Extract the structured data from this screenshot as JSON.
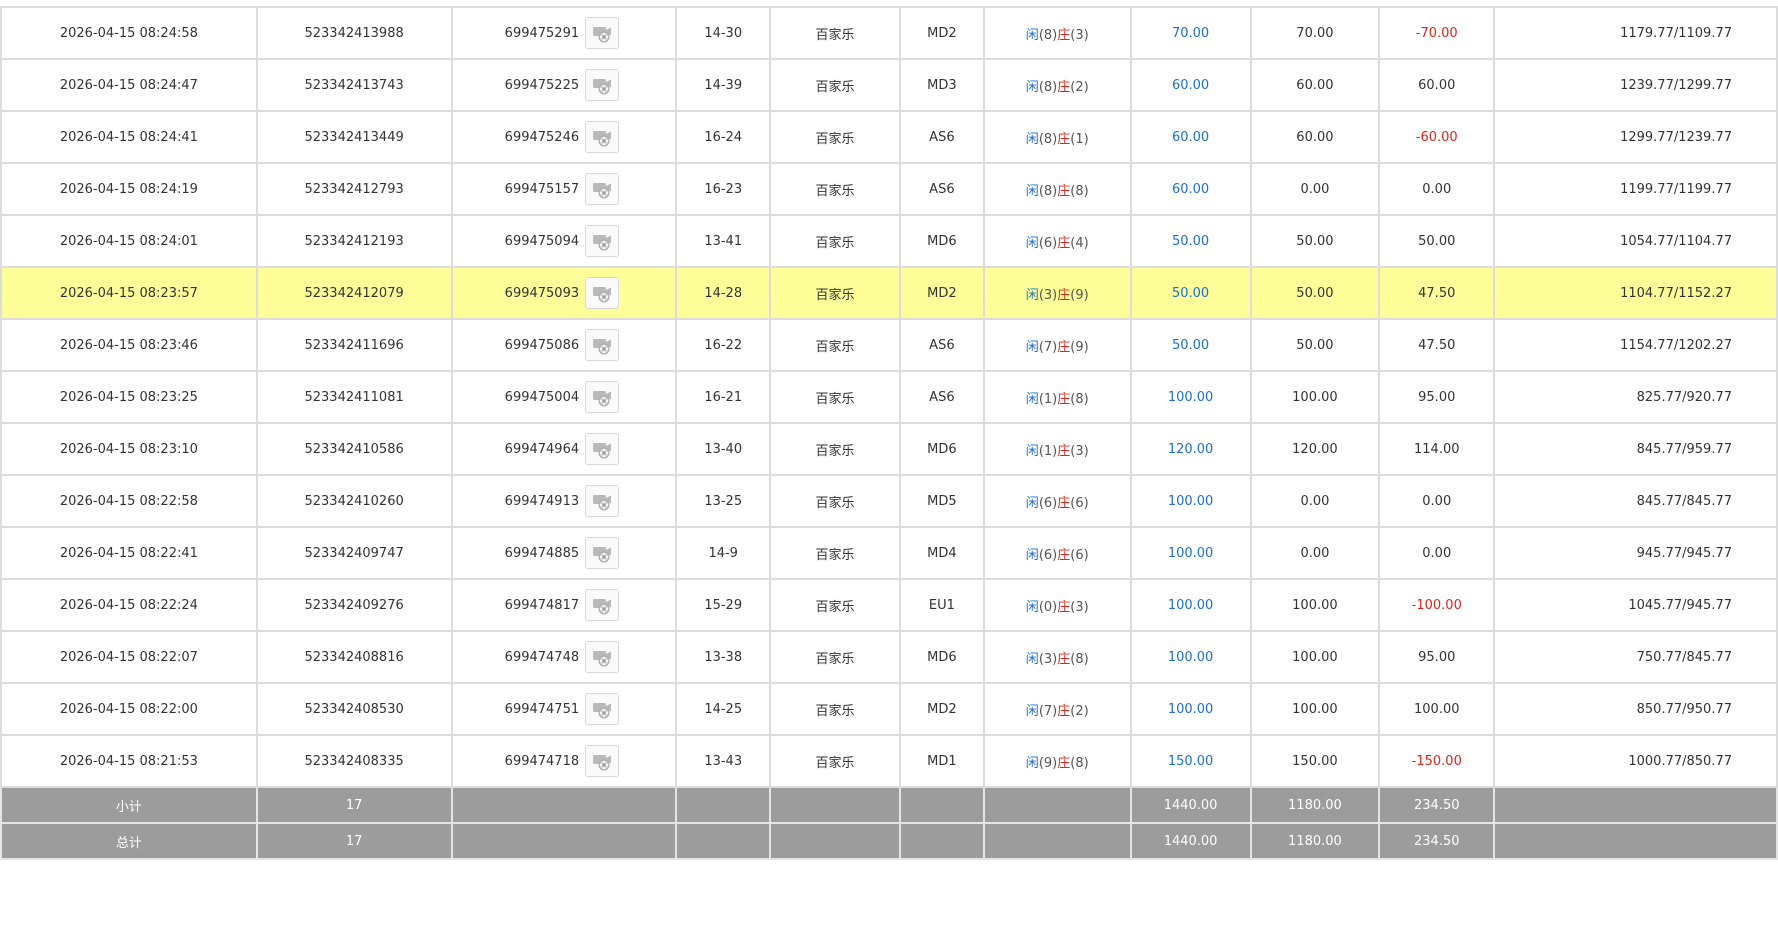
{
  "rows": [
    {
      "time": "2026-04-15 08:24:58",
      "order": "523342413988",
      "game_id": "699475291",
      "table": "14-30",
      "game": "百家乐",
      "table_code": "MD2",
      "p_label": "闲",
      "p_val": "(8)",
      "b_label": "庄",
      "b_val": "(3)",
      "bet": "70.00",
      "valid": "70.00",
      "win": "-70.00",
      "win_neg": true,
      "balance": "1179.77/1109.77",
      "highlight": false
    },
    {
      "time": "2026-04-15 08:24:47",
      "order": "523342413743",
      "game_id": "699475225",
      "table": "14-39",
      "game": "百家乐",
      "table_code": "MD3",
      "p_label": "闲",
      "p_val": "(8)",
      "b_label": "庄",
      "b_val": "(2)",
      "bet": "60.00",
      "valid": "60.00",
      "win": "60.00",
      "win_neg": false,
      "balance": "1239.77/1299.77",
      "highlight": false
    },
    {
      "time": "2026-04-15 08:24:41",
      "order": "523342413449",
      "game_id": "699475246",
      "table": "16-24",
      "game": "百家乐",
      "table_code": "AS6",
      "p_label": "闲",
      "p_val": "(8)",
      "b_label": "庄",
      "b_val": "(1)",
      "bet": "60.00",
      "valid": "60.00",
      "win": "-60.00",
      "win_neg": true,
      "balance": "1299.77/1239.77",
      "highlight": false
    },
    {
      "time": "2026-04-15 08:24:19",
      "order": "523342412793",
      "game_id": "699475157",
      "table": "16-23",
      "game": "百家乐",
      "table_code": "AS6",
      "p_label": "闲",
      "p_val": "(8)",
      "b_label": "庄",
      "b_val": "(8)",
      "bet": "60.00",
      "valid": "0.00",
      "win": "0.00",
      "win_neg": false,
      "balance": "1199.77/1199.77",
      "highlight": false
    },
    {
      "time": "2026-04-15 08:24:01",
      "order": "523342412193",
      "game_id": "699475094",
      "table": "13-41",
      "game": "百家乐",
      "table_code": "MD6",
      "p_label": "闲",
      "p_val": "(6)",
      "b_label": "庄",
      "b_val": "(4)",
      "bet": "50.00",
      "valid": "50.00",
      "win": "50.00",
      "win_neg": false,
      "balance": "1054.77/1104.77",
      "highlight": false
    },
    {
      "time": "2026-04-15 08:23:57",
      "order": "523342412079",
      "game_id": "699475093",
      "table": "14-28",
      "game": "百家乐",
      "table_code": "MD2",
      "p_label": "闲",
      "p_val": "(3)",
      "b_label": "庄",
      "b_val": "(9)",
      "bet": "50.00",
      "valid": "50.00",
      "win": "47.50",
      "win_neg": false,
      "balance": "1104.77/1152.27",
      "highlight": true
    },
    {
      "time": "2026-04-15 08:23:46",
      "order": "523342411696",
      "game_id": "699475086",
      "table": "16-22",
      "game": "百家乐",
      "table_code": "AS6",
      "p_label": "闲",
      "p_val": "(7)",
      "b_label": "庄",
      "b_val": "(9)",
      "bet": "50.00",
      "valid": "50.00",
      "win": "47.50",
      "win_neg": false,
      "balance": "1154.77/1202.27",
      "highlight": false
    },
    {
      "time": "2026-04-15 08:23:25",
      "order": "523342411081",
      "game_id": "699475004",
      "table": "16-21",
      "game": "百家乐",
      "table_code": "AS6",
      "p_label": "闲",
      "p_val": "(1)",
      "b_label": "庄",
      "b_val": "(8)",
      "bet": "100.00",
      "valid": "100.00",
      "win": "95.00",
      "win_neg": false,
      "balance": "825.77/920.77",
      "highlight": false
    },
    {
      "time": "2026-04-15 08:23:10",
      "order": "523342410586",
      "game_id": "699474964",
      "table": "13-40",
      "game": "百家乐",
      "table_code": "MD6",
      "p_label": "闲",
      "p_val": "(1)",
      "b_label": "庄",
      "b_val": "(3)",
      "bet": "120.00",
      "valid": "120.00",
      "win": "114.00",
      "win_neg": false,
      "balance": "845.77/959.77",
      "highlight": false
    },
    {
      "time": "2026-04-15 08:22:58",
      "order": "523342410260",
      "game_id": "699474913",
      "table": "13-25",
      "game": "百家乐",
      "table_code": "MD5",
      "p_label": "闲",
      "p_val": "(6)",
      "b_label": "庄",
      "b_val": "(6)",
      "bet": "100.00",
      "valid": "0.00",
      "win": "0.00",
      "win_neg": false,
      "balance": "845.77/845.77",
      "highlight": false
    },
    {
      "time": "2026-04-15 08:22:41",
      "order": "523342409747",
      "game_id": "699474885",
      "table": "14-9",
      "game": "百家乐",
      "table_code": "MD4",
      "p_label": "闲",
      "p_val": "(6)",
      "b_label": "庄",
      "b_val": "(6)",
      "bet": "100.00",
      "valid": "0.00",
      "win": "0.00",
      "win_neg": false,
      "balance": "945.77/945.77",
      "highlight": false
    },
    {
      "time": "2026-04-15 08:22:24",
      "order": "523342409276",
      "game_id": "699474817",
      "table": "15-29",
      "game": "百家乐",
      "table_code": "EU1",
      "p_label": "闲",
      "p_val": "(0)",
      "b_label": "庄",
      "b_val": "(3)",
      "bet": "100.00",
      "valid": "100.00",
      "win": "-100.00",
      "win_neg": true,
      "balance": "1045.77/945.77",
      "highlight": false
    },
    {
      "time": "2026-04-15 08:22:07",
      "order": "523342408816",
      "game_id": "699474748",
      "table": "13-38",
      "game": "百家乐",
      "table_code": "MD6",
      "p_label": "闲",
      "p_val": "(3)",
      "b_label": "庄",
      "b_val": "(8)",
      "bet": "100.00",
      "valid": "100.00",
      "win": "95.00",
      "win_neg": false,
      "balance": "750.77/845.77",
      "highlight": false
    },
    {
      "time": "2026-04-15 08:22:00",
      "order": "523342408530",
      "game_id": "699474751",
      "table": "14-25",
      "game": "百家乐",
      "table_code": "MD2",
      "p_label": "闲",
      "p_val": "(7)",
      "b_label": "庄",
      "b_val": "(2)",
      "bet": "100.00",
      "valid": "100.00",
      "win": "100.00",
      "win_neg": false,
      "balance": "850.77/950.77",
      "highlight": false
    },
    {
      "time": "2026-04-15 08:21:53",
      "order": "523342408335",
      "game_id": "699474718",
      "table": "13-43",
      "game": "百家乐",
      "table_code": "MD1",
      "p_label": "闲",
      "p_val": "(9)",
      "b_label": "庄",
      "b_val": "(8)",
      "bet": "150.00",
      "valid": "150.00",
      "win": "-150.00",
      "win_neg": true,
      "balance": "1000.77/850.77",
      "highlight": false
    }
  ],
  "subtotal": {
    "label": "小计",
    "count": "17",
    "bet": "1440.00",
    "valid": "1180.00",
    "win": "234.50"
  },
  "total": {
    "label": "总计",
    "count": "17",
    "bet": "1440.00",
    "valid": "1180.00",
    "win": "234.50"
  },
  "icons": {
    "video": "video-replay-icon"
  },
  "colors": {
    "highlight": "#ffff99",
    "player": "#1a6fd6",
    "banker": "#e0241b",
    "summary_bg": "#9c9c9c"
  }
}
